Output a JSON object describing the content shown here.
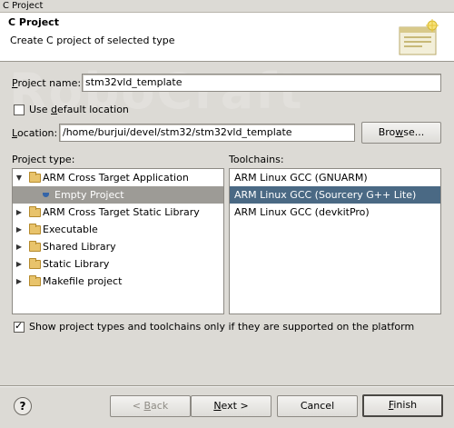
{
  "window": {
    "title": "C Project"
  },
  "header": {
    "title": "C Project",
    "subtitle": "Create C project of selected type"
  },
  "watermark": {
    "text": "RoboCraft"
  },
  "form": {
    "project_name_label_u": "P",
    "project_name_label_rest": "roject name:",
    "project_name_value": "stm32vld_template",
    "use_default_prefix": "Use ",
    "use_default_u": "d",
    "use_default_rest": "efault location",
    "use_default_checked": false,
    "location_label_u": "L",
    "location_label_rest": "ocation:",
    "location_value": "/home/burjui/devel/stm32/stm32vld_template",
    "browse_u": "w",
    "browse_prefix": "Bro",
    "browse_rest": "se..."
  },
  "project_types": {
    "label": "Project type:",
    "items": [
      {
        "label": "ARM Cross Target Application",
        "expander": "▼",
        "kind": "folder",
        "level": 0
      },
      {
        "label": "Empty Project",
        "expander": "",
        "kind": "item",
        "level": 1,
        "selected": true
      },
      {
        "label": "ARM Cross Target Static Library",
        "expander": "▶",
        "kind": "folder",
        "level": 0
      },
      {
        "label": "Executable",
        "expander": "▶",
        "kind": "folder",
        "level": 0
      },
      {
        "label": "Shared Library",
        "expander": "▶",
        "kind": "folder",
        "level": 0
      },
      {
        "label": "Static Library",
        "expander": "▶",
        "kind": "folder",
        "level": 0
      },
      {
        "label": "Makefile project",
        "expander": "▶",
        "kind": "folder",
        "level": 0
      }
    ]
  },
  "toolchains": {
    "label": "Toolchains:",
    "items": [
      {
        "label": "ARM Linux GCC (GNUARM)",
        "selected": false
      },
      {
        "label": "ARM Linux GCC (Sourcery G++ Lite)",
        "selected": true
      },
      {
        "label": "ARM Linux GCC (devkitPro)",
        "selected": false
      }
    ]
  },
  "filter_checkbox": {
    "label": "Show project types and toolchains only if they are supported on the platform",
    "checked": true
  },
  "buttons": {
    "back_prefix": "< ",
    "back_u": "B",
    "back_rest": "ack",
    "next_u": "N",
    "next_rest": "ext >",
    "cancel": "Cancel",
    "finish_u": "F",
    "finish_rest": "inish",
    "help": "?"
  }
}
